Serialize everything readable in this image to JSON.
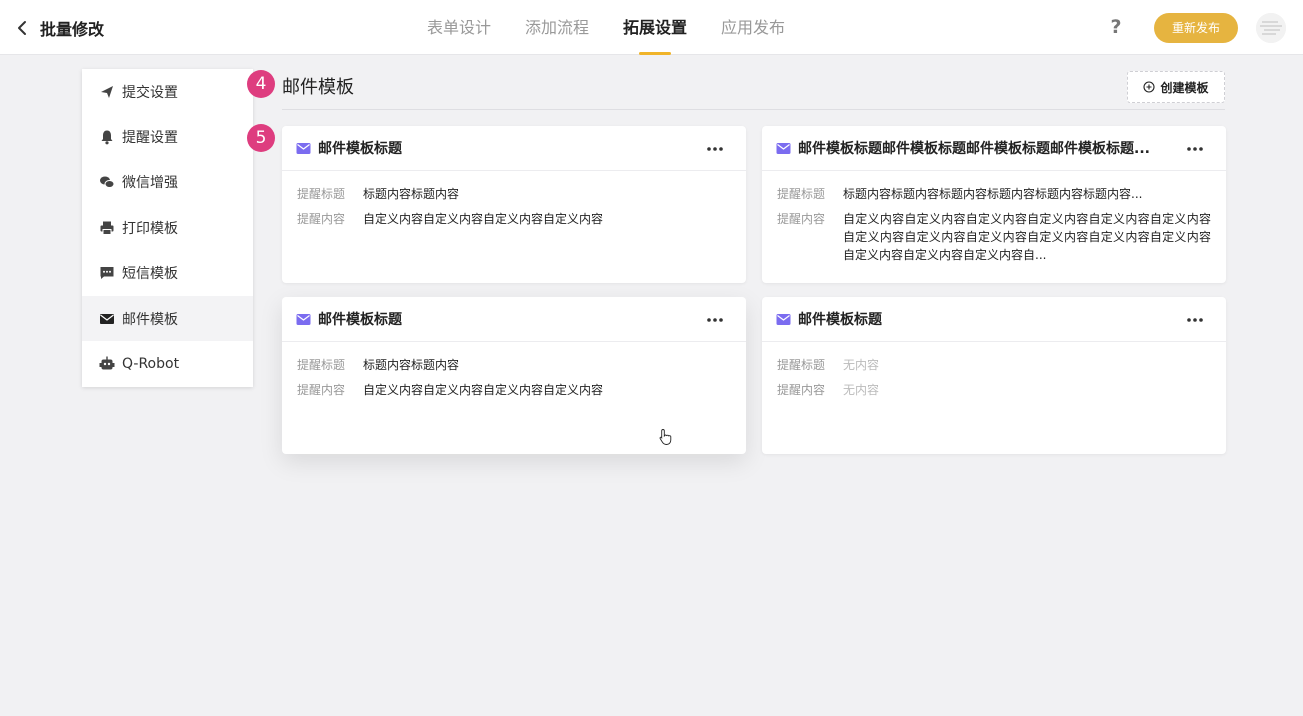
{
  "header": {
    "back_title": "批量修改",
    "tabs": [
      {
        "label": "表单设计",
        "active": false
      },
      {
        "label": "添加流程",
        "active": false
      },
      {
        "label": "拓展设置",
        "active": true
      },
      {
        "label": "应用发布",
        "active": false
      }
    ],
    "help_label": "?",
    "publish_label": "重新发布"
  },
  "sidebar": {
    "items": [
      {
        "label": "提交设置",
        "icon": "paper-plane-icon"
      },
      {
        "label": "提醒设置",
        "icon": "bell-icon"
      },
      {
        "label": "微信增强",
        "icon": "wechat-icon"
      },
      {
        "label": "打印模板",
        "icon": "printer-icon"
      },
      {
        "label": "短信模板",
        "icon": "message-icon"
      },
      {
        "label": "邮件模板",
        "icon": "mail-icon",
        "active": true
      },
      {
        "label": "Q-Robot",
        "icon": "robot-icon"
      }
    ]
  },
  "badges": [
    "4",
    "5"
  ],
  "section": {
    "title": "邮件模板",
    "create_label": "创建模板"
  },
  "cards": [
    {
      "title": "邮件模板标题",
      "subject_label": "提醒标题",
      "subject": "标题内容标题内容",
      "content_label": "提醒内容",
      "content": "自定义内容自定义内容自定义内容自定义内容"
    },
    {
      "title": "邮件模板标题邮件模板标题邮件模板标题邮件模板标题...",
      "subject_label": "提醒标题",
      "subject": "标题内容标题内容标题内容标题内容标题内容标题内容...",
      "content_label": "提醒内容",
      "content": "自定义内容自定义内容自定义内容自定义内容自定义内容自定义内容自定义内容自定义内容自定义内容自定义内容自定义内容自定义内容自定义内容自定义内容自定义内容自...",
      "content_lines": [
        "自定义内容自定义内容自定义内容自定义内容自定义内",
        "容自定义内容自定义内容自定义内容自定义内容自定义",
        "内容自定义内容自定义内容自定义内容自定义内容自..."
      ]
    },
    {
      "title": "邮件模板标题",
      "subject_label": "提醒标题",
      "subject": "标题内容标题内容",
      "content_label": "提醒内容",
      "content": "自定义内容自定义内容自定义内容自定义内容"
    },
    {
      "title": "邮件模板标题",
      "subject_label": "提醒标题",
      "subject": "无内容",
      "content_label": "提醒内容",
      "content": "无内容"
    }
  ],
  "colors": {
    "accent": "#f0b429",
    "publish": "#e6b440",
    "badge": "#de3d7f",
    "mail_icon": "#7b6cf0"
  }
}
